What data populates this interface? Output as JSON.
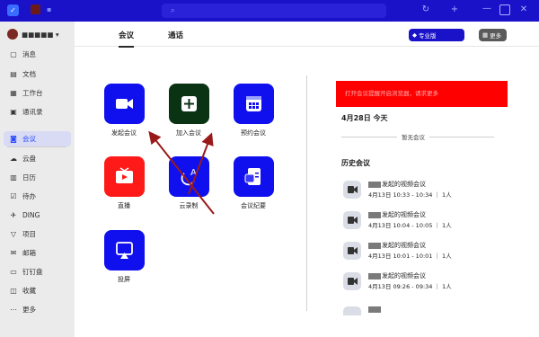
{
  "titlebar": {
    "logo_text": "",
    "search_placeholder": "",
    "icons": [
      "history-icon",
      "add-icon",
      "minimize-icon",
      "maximize-icon",
      "close-icon"
    ]
  },
  "sidebar": {
    "user_name": "■■■■■ ▾",
    "items": [
      {
        "icon": "message-icon",
        "label": "消息"
      },
      {
        "icon": "document-icon",
        "label": "文档"
      },
      {
        "icon": "workbench-icon",
        "label": "工作台"
      },
      {
        "icon": "contacts-icon",
        "label": "通讯录"
      },
      {
        "icon": "video-icon",
        "label": "会议",
        "active": true
      },
      {
        "icon": "cloud-icon",
        "label": "云盘"
      },
      {
        "icon": "calendar-icon",
        "label": "日历"
      },
      {
        "icon": "todo-icon",
        "label": "待办"
      },
      {
        "icon": "ding-icon",
        "label": "DING"
      },
      {
        "icon": "project-icon",
        "label": "项目"
      },
      {
        "icon": "mail-icon",
        "label": "邮箱"
      },
      {
        "icon": "dingpan-icon",
        "label": "钉钉盘"
      },
      {
        "icon": "favorites-icon",
        "label": "收藏"
      },
      {
        "icon": "more-icon",
        "label": "更多"
      }
    ]
  },
  "main": {
    "tabs": [
      {
        "label": "会议"
      },
      {
        "label": "通话"
      }
    ],
    "assistant_button": "专业版",
    "more_button": "更多",
    "actions": [
      {
        "label": "发起会议",
        "color": "#1010ee",
        "icon": "camera-icon"
      },
      {
        "label": "加入会议",
        "color": "#0a3314",
        "icon": "plus-icon"
      },
      {
        "label": "预约会议",
        "color": "#1010ee",
        "icon": "calendar-grid-icon"
      },
      {
        "label": "直播",
        "color": "#ff1a1a",
        "icon": "live-tv-icon"
      },
      {
        "label": "云录制",
        "color": "#1010ee",
        "icon": "cloud-record-icon"
      },
      {
        "label": "会议纪要",
        "color": "#1010ee",
        "icon": "minutes-icon"
      },
      {
        "label": "投屏",
        "color": "#1010ee",
        "icon": "screencast-icon"
      }
    ],
    "banner_text": "打开会议提醒开启浏览器，请求更多",
    "today_title": "4月28日 今天",
    "no_meeting": "暂无会议",
    "history_title": "历史会议",
    "history": [
      {
        "title": "发起的视频会议",
        "meta": "4月13日 10:33 - 10:34 ｜ 1人"
      },
      {
        "title": "发起的视频会议",
        "meta": "4月13日 10:04 - 10:05 ｜ 1人"
      },
      {
        "title": "发起的视频会议",
        "meta": "4月13日 10:01 - 10:01 ｜ 1人"
      },
      {
        "title": "发起的视频会议",
        "meta": "4月13日 09:26 - 09:34 ｜ 1人"
      },
      {
        "title": "",
        "meta": ""
      }
    ]
  },
  "colors": {
    "accent": "#1a12c9",
    "active_blue": "#2a4bff",
    "annotation": "#9a1a1a"
  }
}
